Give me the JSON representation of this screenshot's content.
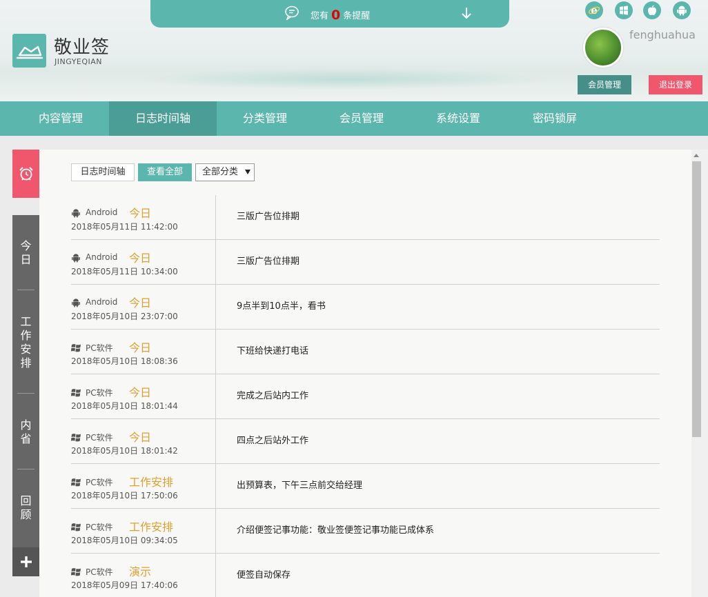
{
  "notice": {
    "prefix": "您有",
    "count": "0",
    "suffix": "条提醒"
  },
  "brand": {
    "name": "敬业签",
    "sub": "JINGYEQIAN"
  },
  "user": {
    "name": "fenghuahua",
    "member_btn": "会员管理",
    "logout_btn": "退出登录"
  },
  "platforms": [
    "ie-icon",
    "windows-icon",
    "apple-icon",
    "android-icon"
  ],
  "nav": [
    "内容管理",
    "日志时间轴",
    "分类管理",
    "会员管理",
    "系统设置",
    "密码锁屏"
  ],
  "sidebar": {
    "today": [
      "今",
      "日"
    ],
    "work": [
      "工",
      "作",
      "安",
      "排"
    ],
    "reflect": [
      "内",
      "省"
    ],
    "review": [
      "回",
      "顾"
    ]
  },
  "filters": {
    "timeline": "日志时间轴",
    "view_all": "查看全部",
    "category": "全部分类"
  },
  "rows": [
    {
      "platform": "Android",
      "icon": "android-icon",
      "category": "今日",
      "time": "2018年05月11日 11:42:00",
      "content": "三版广告位排期"
    },
    {
      "platform": "Android",
      "icon": "android-icon",
      "category": "今日",
      "time": "2018年05月11日 10:34:00",
      "content": "三版广告位排期"
    },
    {
      "platform": "Android",
      "icon": "android-icon",
      "category": "今日",
      "time": "2018年05月10日 23:07:00",
      "content": "9点半到10点半，看书"
    },
    {
      "platform": "PC软件",
      "icon": "windows-icon",
      "category": "今日",
      "time": "2018年05月10日 18:08:36",
      "content": "下班给快递打电话"
    },
    {
      "platform": "PC软件",
      "icon": "windows-icon",
      "category": "今日",
      "time": "2018年05月10日 18:01:44",
      "content": "完成之后站内工作"
    },
    {
      "platform": "PC软件",
      "icon": "windows-icon",
      "category": "今日",
      "time": "2018年05月10日 18:01:42",
      "content": "四点之后站外工作"
    },
    {
      "platform": "PC软件",
      "icon": "windows-icon",
      "category": "工作安排",
      "time": "2018年05月10日 17:50:06",
      "content": "出预算表，下午三点前交给经理"
    },
    {
      "platform": "PC软件",
      "icon": "windows-icon",
      "category": "工作安排",
      "time": "2018年05月10日 09:34:05",
      "content": "介绍便签记事功能：敬业签便签记事功能已成体系"
    },
    {
      "platform": "PC软件",
      "icon": "windows-icon",
      "category": "演示",
      "time": "2018年05月09日 17:40:06",
      "content": "便签自动保存"
    }
  ],
  "colors": {
    "teal": "#5bb7ae",
    "teal_dark": "#4a9e96",
    "red": "#f0566c",
    "gray": "#666666",
    "orange": "#e0a030"
  }
}
